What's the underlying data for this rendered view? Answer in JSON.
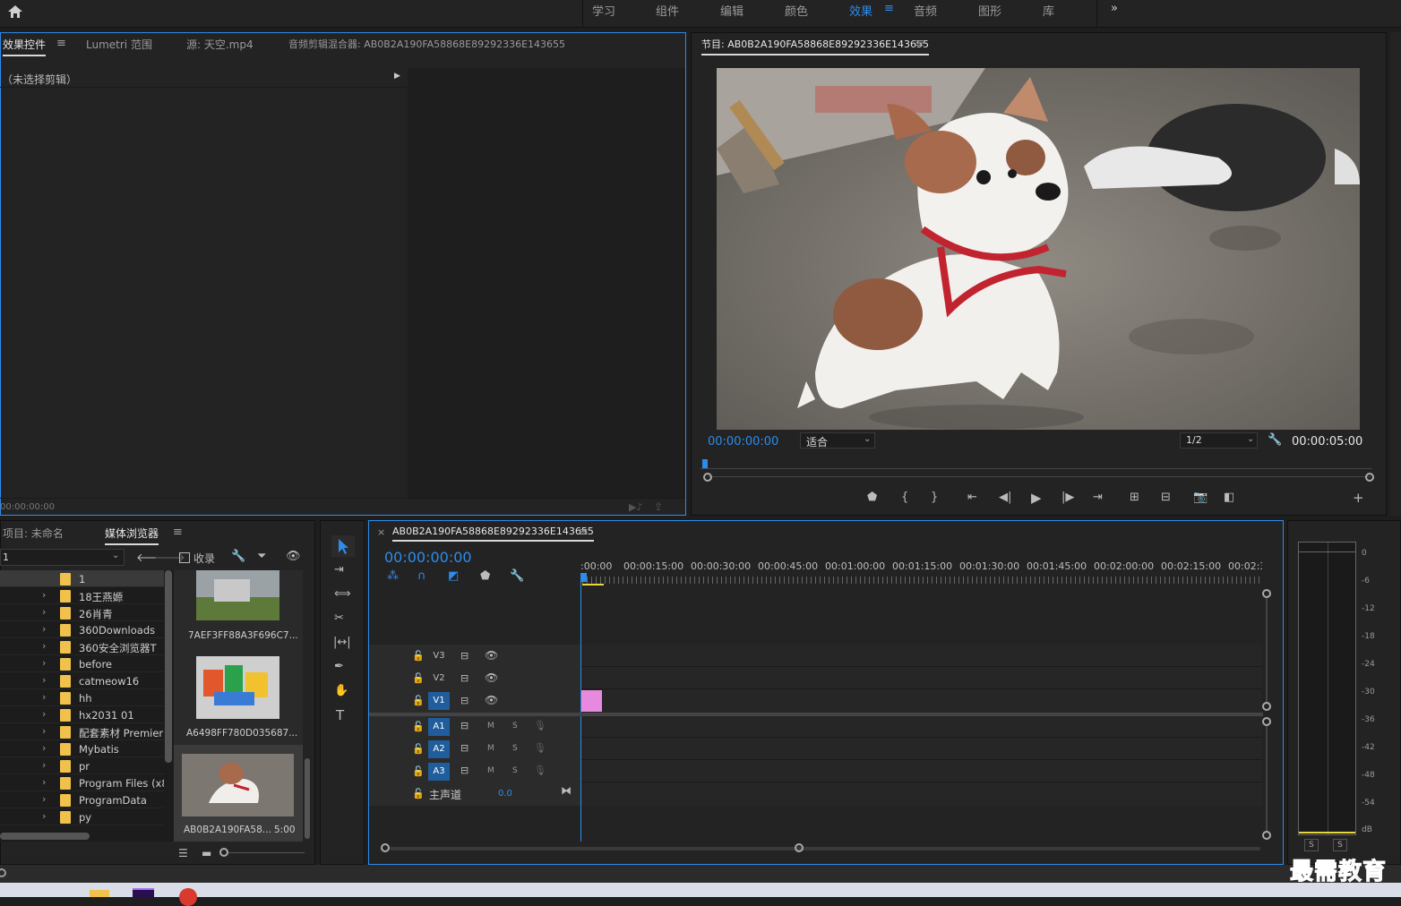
{
  "workspace_tabs": [
    "学习",
    "组件",
    "编辑",
    "颜色",
    "效果",
    "音频",
    "图形",
    "库"
  ],
  "active_workspace": "效果",
  "effect_panel": {
    "tabs": [
      "效果控件",
      "Lumetri 范围",
      "源: 天空.mp4",
      "音频剪辑混合器: AB0B2A190FA58868E89292336E143655"
    ],
    "no_clip": "（未选择剪辑）",
    "timecode": "00:00:00:00"
  },
  "program": {
    "title": "节目: AB0B2A190FA58868E89292336E143655",
    "timecode": "00:00:00:00",
    "fit": "适合",
    "resolution": "1/2",
    "duration": "00:00:05:00"
  },
  "project": {
    "tabs": [
      "项目: 未命名",
      "媒体浏览器"
    ],
    "path_select": "1",
    "ingest": "收录"
  },
  "folders": [
    "1",
    "18王燕嫄",
    "26肖青",
    "360Downloads",
    "360安全浏览器T",
    "before",
    "catmeow16",
    "hh",
    "hx2031 01",
    "配套素材 Premier",
    "Mybatis",
    "pr",
    "Program Files (x86",
    "ProgramData",
    "py"
  ],
  "thumbnails": [
    {
      "label": "7AEF3FF88A3F696C7...",
      "duration": ""
    },
    {
      "label": "A6498FF780D035687...",
      "duration": ""
    },
    {
      "label": "AB0B2A190FA58...",
      "duration": "5:00"
    }
  ],
  "timeline": {
    "title": "AB0B2A190FA58868E89292336E143655",
    "timecode": "00:00:00:00",
    "ruler": [
      ":00:00",
      "00:00:15:00",
      "00:00:30:00",
      "00:00:45:00",
      "00:01:00:00",
      "00:01:15:00",
      "00:01:30:00",
      "00:01:45:00",
      "00:02:00:00",
      "00:02:15:00",
      "00:02:3("
    ],
    "video_tracks": [
      "V3",
      "V2",
      "V1"
    ],
    "audio_tracks": [
      "A1",
      "A2",
      "A3"
    ],
    "master": "主声道",
    "master_value": "0.0",
    "m": "M",
    "s": "S"
  },
  "meter": {
    "labels": [
      "0",
      "-6",
      "-12",
      "-18",
      "-24",
      "-30",
      "-36",
      "-42",
      "-48",
      "-54",
      "dB"
    ],
    "solo": [
      "S",
      "S"
    ]
  },
  "watermark": "最需教育",
  "colors": {
    "accent": "#2d8ceb",
    "clip": "#e889e0",
    "folder": "#f0c24b"
  }
}
